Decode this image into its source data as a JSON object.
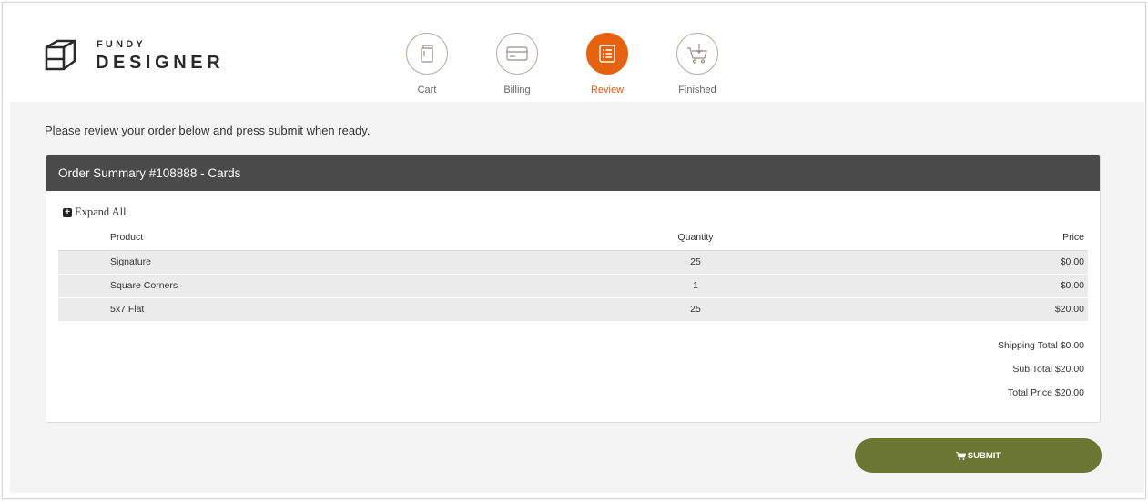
{
  "brand": {
    "top": "FUNDY",
    "bottom": "DESIGNER"
  },
  "steps": [
    {
      "label": "Cart",
      "icon": "book-icon",
      "active": false
    },
    {
      "label": "Billing",
      "icon": "credit-card-icon",
      "active": false
    },
    {
      "label": "Review",
      "icon": "list-icon",
      "active": true
    },
    {
      "label": "Finished",
      "icon": "cart-download-icon",
      "active": false
    }
  ],
  "instructions": "Please review your order below and press submit when ready.",
  "order": {
    "title": "Order Summary #108888 - Cards",
    "expand_label": "Expand All",
    "columns": {
      "product": "Product",
      "quantity": "Quantity",
      "price": "Price"
    },
    "items": [
      {
        "product": "Signature",
        "quantity": "25",
        "price": "$0.00"
      },
      {
        "product": "Square Corners",
        "quantity": "1",
        "price": "$0.00"
      },
      {
        "product": "5x7 Flat",
        "quantity": "25",
        "price": "$20.00"
      }
    ],
    "totals": {
      "shipping": "Shipping Total $0.00",
      "sub": "Sub Total $20.00",
      "total": "Total Price $20.00"
    }
  },
  "submit_label": "SUBMIT",
  "colors": {
    "accent": "#e6620f",
    "submit": "#6b7633",
    "panel_header": "#4a4a4b",
    "background": "#f4f4f4"
  }
}
